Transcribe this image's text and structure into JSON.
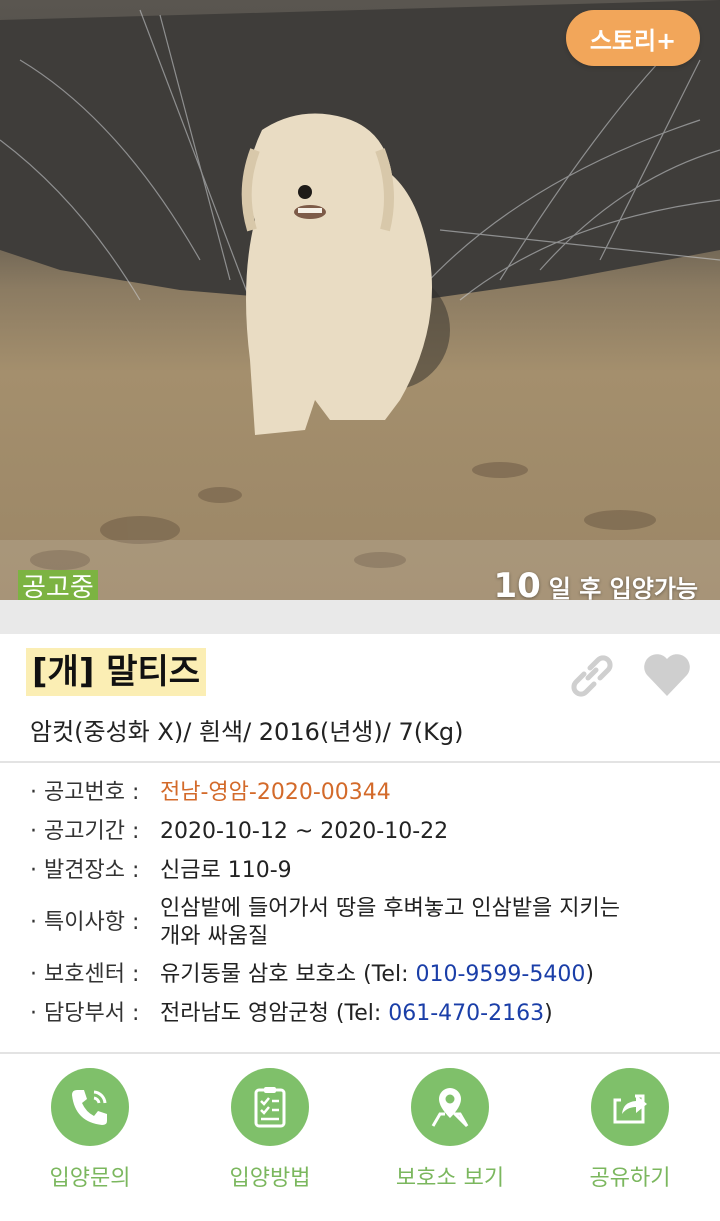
{
  "photo": {
    "story_button": "스토리+",
    "status_badge": "공고중",
    "adopt_days_number": "10",
    "adopt_days_text": "일 후 입양가능"
  },
  "animal": {
    "title": "[개] 말티즈",
    "subtitle": "암컷(중성화 X)/ 흰색/ 2016(년생)/ 7(Kg)"
  },
  "info": {
    "notice_no_label": "· 공고번호 :",
    "notice_no": "전남-영암-2020-00344",
    "period_label": "· 공고기간 :",
    "period": "2020-10-12 ~ 2020-10-22",
    "found_label": "· 발견장소 :",
    "found": "신금로 110-9",
    "notes_label": "· 특이사항 :",
    "notes_line1": "인삼밭에 들어가서 땅을 후벼놓고 인삼밭을 지키는",
    "notes_line2": "개와 싸움질",
    "center_label": "· 보호센터 :",
    "center_name": "유기동물 삼호 보호소 (Tel: ",
    "center_tel": "010-9599-5400",
    "center_close": ")",
    "dept_label": "· 담당부서 :",
    "dept_name": "전라남도 영암군청 (Tel: ",
    "dept_tel": "061-470-2163",
    "dept_close": ")"
  },
  "actions": [
    {
      "label": "입양문의",
      "icon": "phone-icon"
    },
    {
      "label": "입양방법",
      "icon": "clipboard-icon"
    },
    {
      "label": "보호소 보기",
      "icon": "map-pin-icon"
    },
    {
      "label": "공유하기",
      "icon": "share-icon"
    }
  ],
  "colors": {
    "accent_orange": "#f2a65a",
    "badge_green": "#7cb342",
    "action_green": "#7fc06a",
    "notice_no": "#d36a2a",
    "tel_blue": "#1a3ea8"
  }
}
